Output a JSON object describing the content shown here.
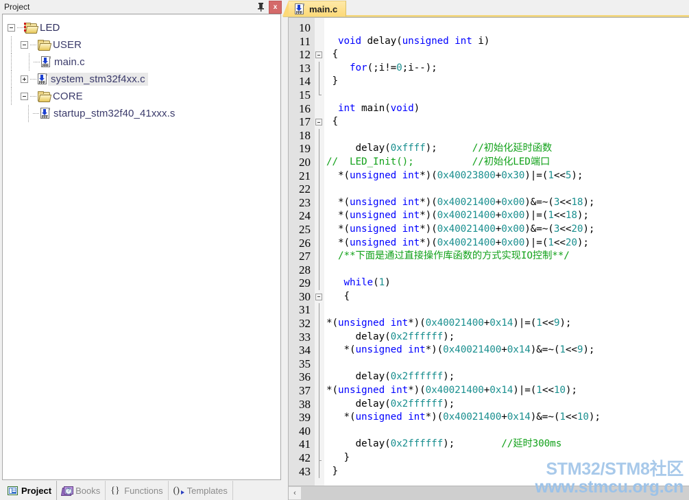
{
  "project_panel": {
    "title": "Project",
    "pin_tooltip": "Auto Hide",
    "close_label": "x",
    "tree": [
      {
        "label": "LED",
        "level": 0,
        "icon": "project-folder-icon",
        "expander": "minus",
        "selected": false
      },
      {
        "label": "USER",
        "level": 1,
        "icon": "folder-icon",
        "expander": "minus",
        "selected": false
      },
      {
        "label": "main.c",
        "level": 2,
        "icon": "c-file-icon",
        "expander": "none",
        "selected": false
      },
      {
        "label": "system_stm32f4xx.c",
        "level": 2,
        "icon": "c-file-icon",
        "expander": "plus",
        "selected": true
      },
      {
        "label": "CORE",
        "level": 1,
        "icon": "folder-icon",
        "expander": "minus",
        "selected": false
      },
      {
        "label": "startup_stm32f40_41xxx.s",
        "level": 2,
        "icon": "c-file-icon",
        "expander": "none",
        "selected": false
      }
    ],
    "tabs": [
      {
        "label": "Project",
        "icon": "project-window-icon",
        "active": true
      },
      {
        "label": "Books",
        "icon": "books-icon",
        "active": false
      },
      {
        "label": "Functions",
        "icon": "braces-icon",
        "active": false
      },
      {
        "label": "Templates",
        "icon": "templates-icon",
        "active": false
      }
    ]
  },
  "editor": {
    "tabs": [
      {
        "label": "main.c",
        "icon": "c-file-icon",
        "active": true
      }
    ],
    "scroll_left_label": "‹",
    "first_line_number": 10,
    "lines": [
      {
        "n": 10,
        "fold": "none",
        "segs": []
      },
      {
        "n": 11,
        "fold": "none",
        "segs": [
          {
            "t": "  ",
            "c": ""
          },
          {
            "t": "void",
            "c": "kw"
          },
          {
            "t": " delay(",
            "c": ""
          },
          {
            "t": "unsigned int",
            "c": "kw"
          },
          {
            "t": " i)",
            "c": ""
          }
        ]
      },
      {
        "n": 12,
        "fold": "start",
        "segs": [
          {
            "t": " {",
            "c": ""
          }
        ]
      },
      {
        "n": 13,
        "fold": "bar",
        "segs": [
          {
            "t": "    ",
            "c": ""
          },
          {
            "t": "for",
            "c": "kw"
          },
          {
            "t": "(;i!=",
            "c": ""
          },
          {
            "t": "0",
            "c": "num"
          },
          {
            "t": ";i--);",
            "c": ""
          }
        ]
      },
      {
        "n": 14,
        "fold": "bar",
        "segs": [
          {
            "t": " }",
            "c": ""
          }
        ]
      },
      {
        "n": 15,
        "fold": "end",
        "segs": []
      },
      {
        "n": 16,
        "fold": "none",
        "segs": [
          {
            "t": "  ",
            "c": ""
          },
          {
            "t": "int",
            "c": "kw"
          },
          {
            "t": " main(",
            "c": ""
          },
          {
            "t": "void",
            "c": "kw"
          },
          {
            "t": ")",
            "c": ""
          }
        ]
      },
      {
        "n": 17,
        "fold": "start",
        "segs": [
          {
            "t": " {",
            "c": ""
          }
        ]
      },
      {
        "n": 18,
        "fold": "bar",
        "segs": []
      },
      {
        "n": 19,
        "fold": "bar",
        "segs": [
          {
            "t": "     delay(",
            "c": ""
          },
          {
            "t": "0xffff",
            "c": "num"
          },
          {
            "t": ");      ",
            "c": ""
          },
          {
            "t": "//初始化延时函数",
            "c": "cmt"
          }
        ]
      },
      {
        "n": 20,
        "fold": "bar",
        "segs": [
          {
            "t": "//  LED_Init();          //初始化LED端口",
            "c": "cmt"
          }
        ]
      },
      {
        "n": 21,
        "fold": "bar",
        "segs": [
          {
            "t": "  *(",
            "c": ""
          },
          {
            "t": "unsigned int",
            "c": "kw"
          },
          {
            "t": "*)(",
            "c": ""
          },
          {
            "t": "0x40023800",
            "c": "num"
          },
          {
            "t": "+",
            "c": ""
          },
          {
            "t": "0x30",
            "c": "num"
          },
          {
            "t": ")|=(",
            "c": ""
          },
          {
            "t": "1",
            "c": "num"
          },
          {
            "t": "<<",
            "c": ""
          },
          {
            "t": "5",
            "c": "num"
          },
          {
            "t": ");",
            "c": ""
          }
        ]
      },
      {
        "n": 22,
        "fold": "bar",
        "segs": []
      },
      {
        "n": 23,
        "fold": "bar",
        "segs": [
          {
            "t": "  *(",
            "c": ""
          },
          {
            "t": "unsigned int",
            "c": "kw"
          },
          {
            "t": "*)(",
            "c": ""
          },
          {
            "t": "0x40021400",
            "c": "num"
          },
          {
            "t": "+",
            "c": ""
          },
          {
            "t": "0x00",
            "c": "num"
          },
          {
            "t": ")&=~(",
            "c": ""
          },
          {
            "t": "3",
            "c": "num"
          },
          {
            "t": "<<",
            "c": ""
          },
          {
            "t": "18",
            "c": "num"
          },
          {
            "t": ");",
            "c": ""
          }
        ]
      },
      {
        "n": 24,
        "fold": "bar",
        "segs": [
          {
            "t": "  *(",
            "c": ""
          },
          {
            "t": "unsigned int",
            "c": "kw"
          },
          {
            "t": "*)(",
            "c": ""
          },
          {
            "t": "0x40021400",
            "c": "num"
          },
          {
            "t": "+",
            "c": ""
          },
          {
            "t": "0x00",
            "c": "num"
          },
          {
            "t": ")|=(",
            "c": ""
          },
          {
            "t": "1",
            "c": "num"
          },
          {
            "t": "<<",
            "c": ""
          },
          {
            "t": "18",
            "c": "num"
          },
          {
            "t": ");",
            "c": ""
          }
        ]
      },
      {
        "n": 25,
        "fold": "bar",
        "segs": [
          {
            "t": "  *(",
            "c": ""
          },
          {
            "t": "unsigned int",
            "c": "kw"
          },
          {
            "t": "*)(",
            "c": ""
          },
          {
            "t": "0x40021400",
            "c": "num"
          },
          {
            "t": "+",
            "c": ""
          },
          {
            "t": "0x00",
            "c": "num"
          },
          {
            "t": ")&=~(",
            "c": ""
          },
          {
            "t": "3",
            "c": "num"
          },
          {
            "t": "<<",
            "c": ""
          },
          {
            "t": "20",
            "c": "num"
          },
          {
            "t": ");",
            "c": ""
          }
        ]
      },
      {
        "n": 26,
        "fold": "bar",
        "segs": [
          {
            "t": "  *(",
            "c": ""
          },
          {
            "t": "unsigned int",
            "c": "kw"
          },
          {
            "t": "*)(",
            "c": ""
          },
          {
            "t": "0x40021400",
            "c": "num"
          },
          {
            "t": "+",
            "c": ""
          },
          {
            "t": "0x00",
            "c": "num"
          },
          {
            "t": ")|=(",
            "c": ""
          },
          {
            "t": "1",
            "c": "num"
          },
          {
            "t": "<<",
            "c": ""
          },
          {
            "t": "20",
            "c": "num"
          },
          {
            "t": ");",
            "c": ""
          }
        ]
      },
      {
        "n": 27,
        "fold": "bar",
        "segs": [
          {
            "t": "  /**下面是通过直接操作库函数的方式实现IO控制**/",
            "c": "cmt"
          }
        ]
      },
      {
        "n": 28,
        "fold": "bar",
        "segs": []
      },
      {
        "n": 29,
        "fold": "bar",
        "segs": [
          {
            "t": "   ",
            "c": ""
          },
          {
            "t": "while",
            "c": "kw"
          },
          {
            "t": "(",
            "c": ""
          },
          {
            "t": "1",
            "c": "num"
          },
          {
            "t": ")",
            "c": ""
          }
        ]
      },
      {
        "n": 30,
        "fold": "start",
        "segs": [
          {
            "t": "   {",
            "c": ""
          }
        ]
      },
      {
        "n": 31,
        "fold": "bar",
        "segs": []
      },
      {
        "n": 32,
        "fold": "bar",
        "segs": [
          {
            "t": "*(",
            "c": ""
          },
          {
            "t": "unsigned int",
            "c": "kw"
          },
          {
            "t": "*)(",
            "c": ""
          },
          {
            "t": "0x40021400",
            "c": "num"
          },
          {
            "t": "+",
            "c": ""
          },
          {
            "t": "0x14",
            "c": "num"
          },
          {
            "t": ")|=(",
            "c": ""
          },
          {
            "t": "1",
            "c": "num"
          },
          {
            "t": "<<",
            "c": ""
          },
          {
            "t": "9",
            "c": "num"
          },
          {
            "t": ");",
            "c": ""
          }
        ]
      },
      {
        "n": 33,
        "fold": "bar",
        "segs": [
          {
            "t": "     delay(",
            "c": ""
          },
          {
            "t": "0x2ffffff",
            "c": "num"
          },
          {
            "t": ");",
            "c": ""
          }
        ]
      },
      {
        "n": 34,
        "fold": "bar",
        "segs": [
          {
            "t": "   *(",
            "c": ""
          },
          {
            "t": "unsigned int",
            "c": "kw"
          },
          {
            "t": "*)(",
            "c": ""
          },
          {
            "t": "0x40021400",
            "c": "num"
          },
          {
            "t": "+",
            "c": ""
          },
          {
            "t": "0x14",
            "c": "num"
          },
          {
            "t": ")&=~(",
            "c": ""
          },
          {
            "t": "1",
            "c": "num"
          },
          {
            "t": "<<",
            "c": ""
          },
          {
            "t": "9",
            "c": "num"
          },
          {
            "t": ");",
            "c": ""
          }
        ]
      },
      {
        "n": 35,
        "fold": "bar",
        "segs": []
      },
      {
        "n": 36,
        "fold": "bar",
        "segs": [
          {
            "t": "     delay(",
            "c": ""
          },
          {
            "t": "0x2ffffff",
            "c": "num"
          },
          {
            "t": ");",
            "c": ""
          }
        ]
      },
      {
        "n": 37,
        "fold": "bar",
        "segs": [
          {
            "t": "*(",
            "c": ""
          },
          {
            "t": "unsigned int",
            "c": "kw"
          },
          {
            "t": "*)(",
            "c": ""
          },
          {
            "t": "0x40021400",
            "c": "num"
          },
          {
            "t": "+",
            "c": ""
          },
          {
            "t": "0x14",
            "c": "num"
          },
          {
            "t": ")|=(",
            "c": ""
          },
          {
            "t": "1",
            "c": "num"
          },
          {
            "t": "<<",
            "c": ""
          },
          {
            "t": "10",
            "c": "num"
          },
          {
            "t": ");",
            "c": ""
          }
        ]
      },
      {
        "n": 38,
        "fold": "bar",
        "segs": [
          {
            "t": "     delay(",
            "c": ""
          },
          {
            "t": "0x2ffffff",
            "c": "num"
          },
          {
            "t": ");",
            "c": ""
          }
        ]
      },
      {
        "n": 39,
        "fold": "bar",
        "segs": [
          {
            "t": "   *(",
            "c": ""
          },
          {
            "t": "unsigned int",
            "c": "kw"
          },
          {
            "t": "*)(",
            "c": ""
          },
          {
            "t": "0x40021400",
            "c": "num"
          },
          {
            "t": "+",
            "c": ""
          },
          {
            "t": "0x14",
            "c": "num"
          },
          {
            "t": ")&=~(",
            "c": ""
          },
          {
            "t": "1",
            "c": "num"
          },
          {
            "t": "<<",
            "c": ""
          },
          {
            "t": "10",
            "c": "num"
          },
          {
            "t": ");",
            "c": ""
          }
        ]
      },
      {
        "n": 40,
        "fold": "bar",
        "segs": []
      },
      {
        "n": 41,
        "fold": "bar",
        "segs": [
          {
            "t": "     delay(",
            "c": ""
          },
          {
            "t": "0x2ffffff",
            "c": "num"
          },
          {
            "t": ");        ",
            "c": ""
          },
          {
            "t": "//延时300ms",
            "c": "cmt"
          }
        ]
      },
      {
        "n": 42,
        "fold": "endbar",
        "segs": [
          {
            "t": "   }",
            "c": ""
          }
        ]
      },
      {
        "n": 43,
        "fold": "bar",
        "segs": [
          {
            "t": " }",
            "c": ""
          }
        ]
      }
    ]
  },
  "watermark": {
    "line1": "STM32/STM8社区",
    "line2": "www.stmcu.org.cn"
  },
  "colors": {
    "keyword": "#0000ff",
    "number": "#1a8f8f",
    "comment": "#12a11a",
    "tab_active": "#fcd978",
    "close_button": "#d46a6a",
    "watermark": "#a8c9ea"
  }
}
